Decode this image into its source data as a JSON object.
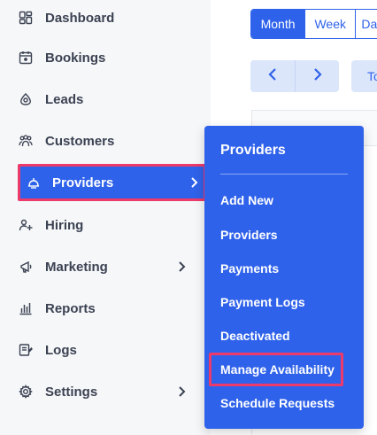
{
  "sidebar": {
    "items": [
      {
        "label": "Dashboard",
        "icon": "dashboard-icon"
      },
      {
        "label": "Bookings",
        "icon": "calendar-icon"
      },
      {
        "label": "Leads",
        "icon": "leads-icon"
      },
      {
        "label": "Customers",
        "icon": "customers-icon"
      },
      {
        "label": "Providers",
        "icon": "providers-icon",
        "active": true
      },
      {
        "label": "Hiring",
        "icon": "hiring-icon"
      },
      {
        "label": "Marketing",
        "icon": "megaphone-icon"
      },
      {
        "label": "Reports",
        "icon": "reports-icon"
      },
      {
        "label": "Logs",
        "icon": "logs-icon"
      },
      {
        "label": "Settings",
        "icon": "gear-icon"
      }
    ]
  },
  "calendar": {
    "views": [
      "Month",
      "Week",
      "Da"
    ],
    "active_view": "Month",
    "today_label": "To"
  },
  "providers_menu": {
    "title": "Providers",
    "items": [
      "Add New",
      "Providers",
      "Payments",
      "Payment Logs",
      "Deactivated",
      "Manage Availability",
      "Schedule Requests"
    ],
    "highlighted": "Manage Availability"
  },
  "colors": {
    "accent": "#2f62ea",
    "highlight": "#ec3a6b",
    "sidebar_bg": "#f6f7f9"
  }
}
